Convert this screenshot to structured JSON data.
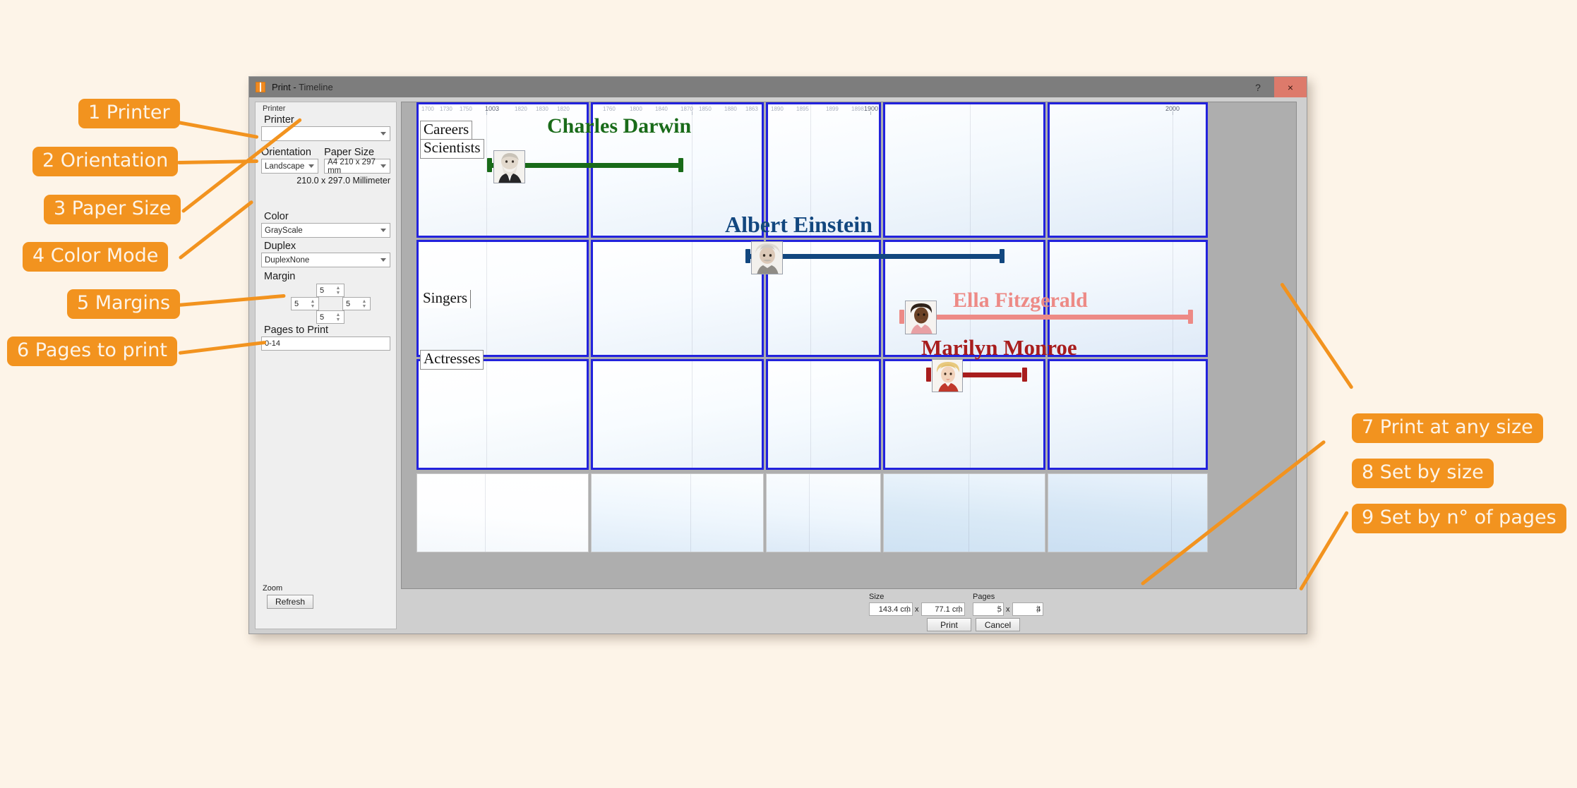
{
  "window": {
    "title_main": "Print",
    "title_sep": " - ",
    "title_doc": "Timeline",
    "help_glyph": "?",
    "close_glyph": "×"
  },
  "printer_panel": {
    "group_label": "Printer",
    "printer_label": "Printer",
    "printer_value": "",
    "orientation_label": "Orientation",
    "orientation_value": "Landscape",
    "paper_size_label": "Paper Size",
    "paper_size_value": "A4 210 x 297 mm",
    "paper_dims_text": "210.0 x 297.0 Millimeter",
    "color_label": "Color",
    "color_value": "GrayScale",
    "duplex_label": "Duplex",
    "duplex_value": "DuplexNone",
    "margin_label": "Margin",
    "margin_top": "5",
    "margin_left": "5",
    "margin_right": "5",
    "margin_bottom": "5",
    "pages_to_print_label": "Pages to Print",
    "pages_to_print_value": "0-14",
    "zoom_label": "Zoom",
    "refresh_label": "Refresh"
  },
  "footer": {
    "size_label": "Size",
    "size_width": "143.4 cm",
    "size_height": "77.1 cm",
    "size_sep": "x",
    "pages_label": "Pages",
    "pages_cols": "5",
    "pages_rows": "4",
    "pages_sep": "x",
    "print_label": "Print",
    "cancel_label": "Cancel"
  },
  "timeline": {
    "categories": [
      {
        "label": "Careers"
      },
      {
        "label": "Scientists"
      },
      {
        "label": "Singers"
      },
      {
        "label": "Actresses"
      }
    ],
    "ruler_years": [
      "1003",
      "1800",
      "1850",
      "1900",
      "2000"
    ],
    "events": [
      {
        "name": "Charles Darwin",
        "color": "#196b19",
        "portrait": "charles-darwin-portrait"
      },
      {
        "name": "Albert Einstein",
        "color": "#12477f",
        "portrait": "albert-einstein-portrait"
      },
      {
        "name": "Ella Fitzgerald",
        "color": "#ed8a86",
        "portrait": "ella-fitzgerald-portrait"
      },
      {
        "name": "Marilyn Monroe",
        "color": "#a81d1d",
        "portrait": "marilyn-monroe-portrait"
      }
    ],
    "page_grid": {
      "columns": 5,
      "rows": 4
    }
  },
  "annotations": {
    "accent_color": "#f2931f",
    "text_color": "#fdf4e8",
    "left": [
      {
        "text": "1 Printer"
      },
      {
        "text": "2 Orientation"
      },
      {
        "text": "3 Paper Size"
      },
      {
        "text": "4 Color Mode"
      },
      {
        "text": "5 Margins"
      },
      {
        "text": "6 Pages to print"
      }
    ],
    "right": [
      {
        "text": "7 Print at any size"
      },
      {
        "text": "8 Set by size"
      },
      {
        "text": "9 Set by n° of pages"
      }
    ]
  }
}
